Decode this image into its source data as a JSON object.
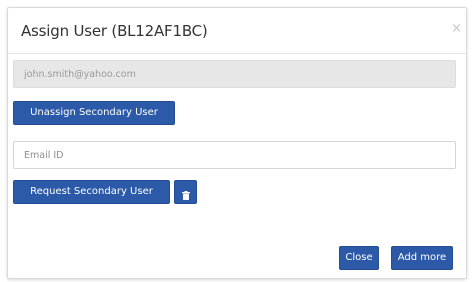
{
  "modal": {
    "title": "Assign User (BL12AF1BC)",
    "close_glyph": "×"
  },
  "secondary_user_field": {
    "value": "john.smith@yahoo.com"
  },
  "buttons": {
    "unassign": "Unassign Secondary User",
    "request": "Request Secondary User",
    "delete_icon": "trash-icon",
    "close": "Close",
    "add_more": "Add more"
  },
  "email_field": {
    "placeholder": "Email ID",
    "value": ""
  },
  "colors": {
    "primary": "#2c5aa8",
    "disabled_field_bg": "#e7e7e7"
  }
}
